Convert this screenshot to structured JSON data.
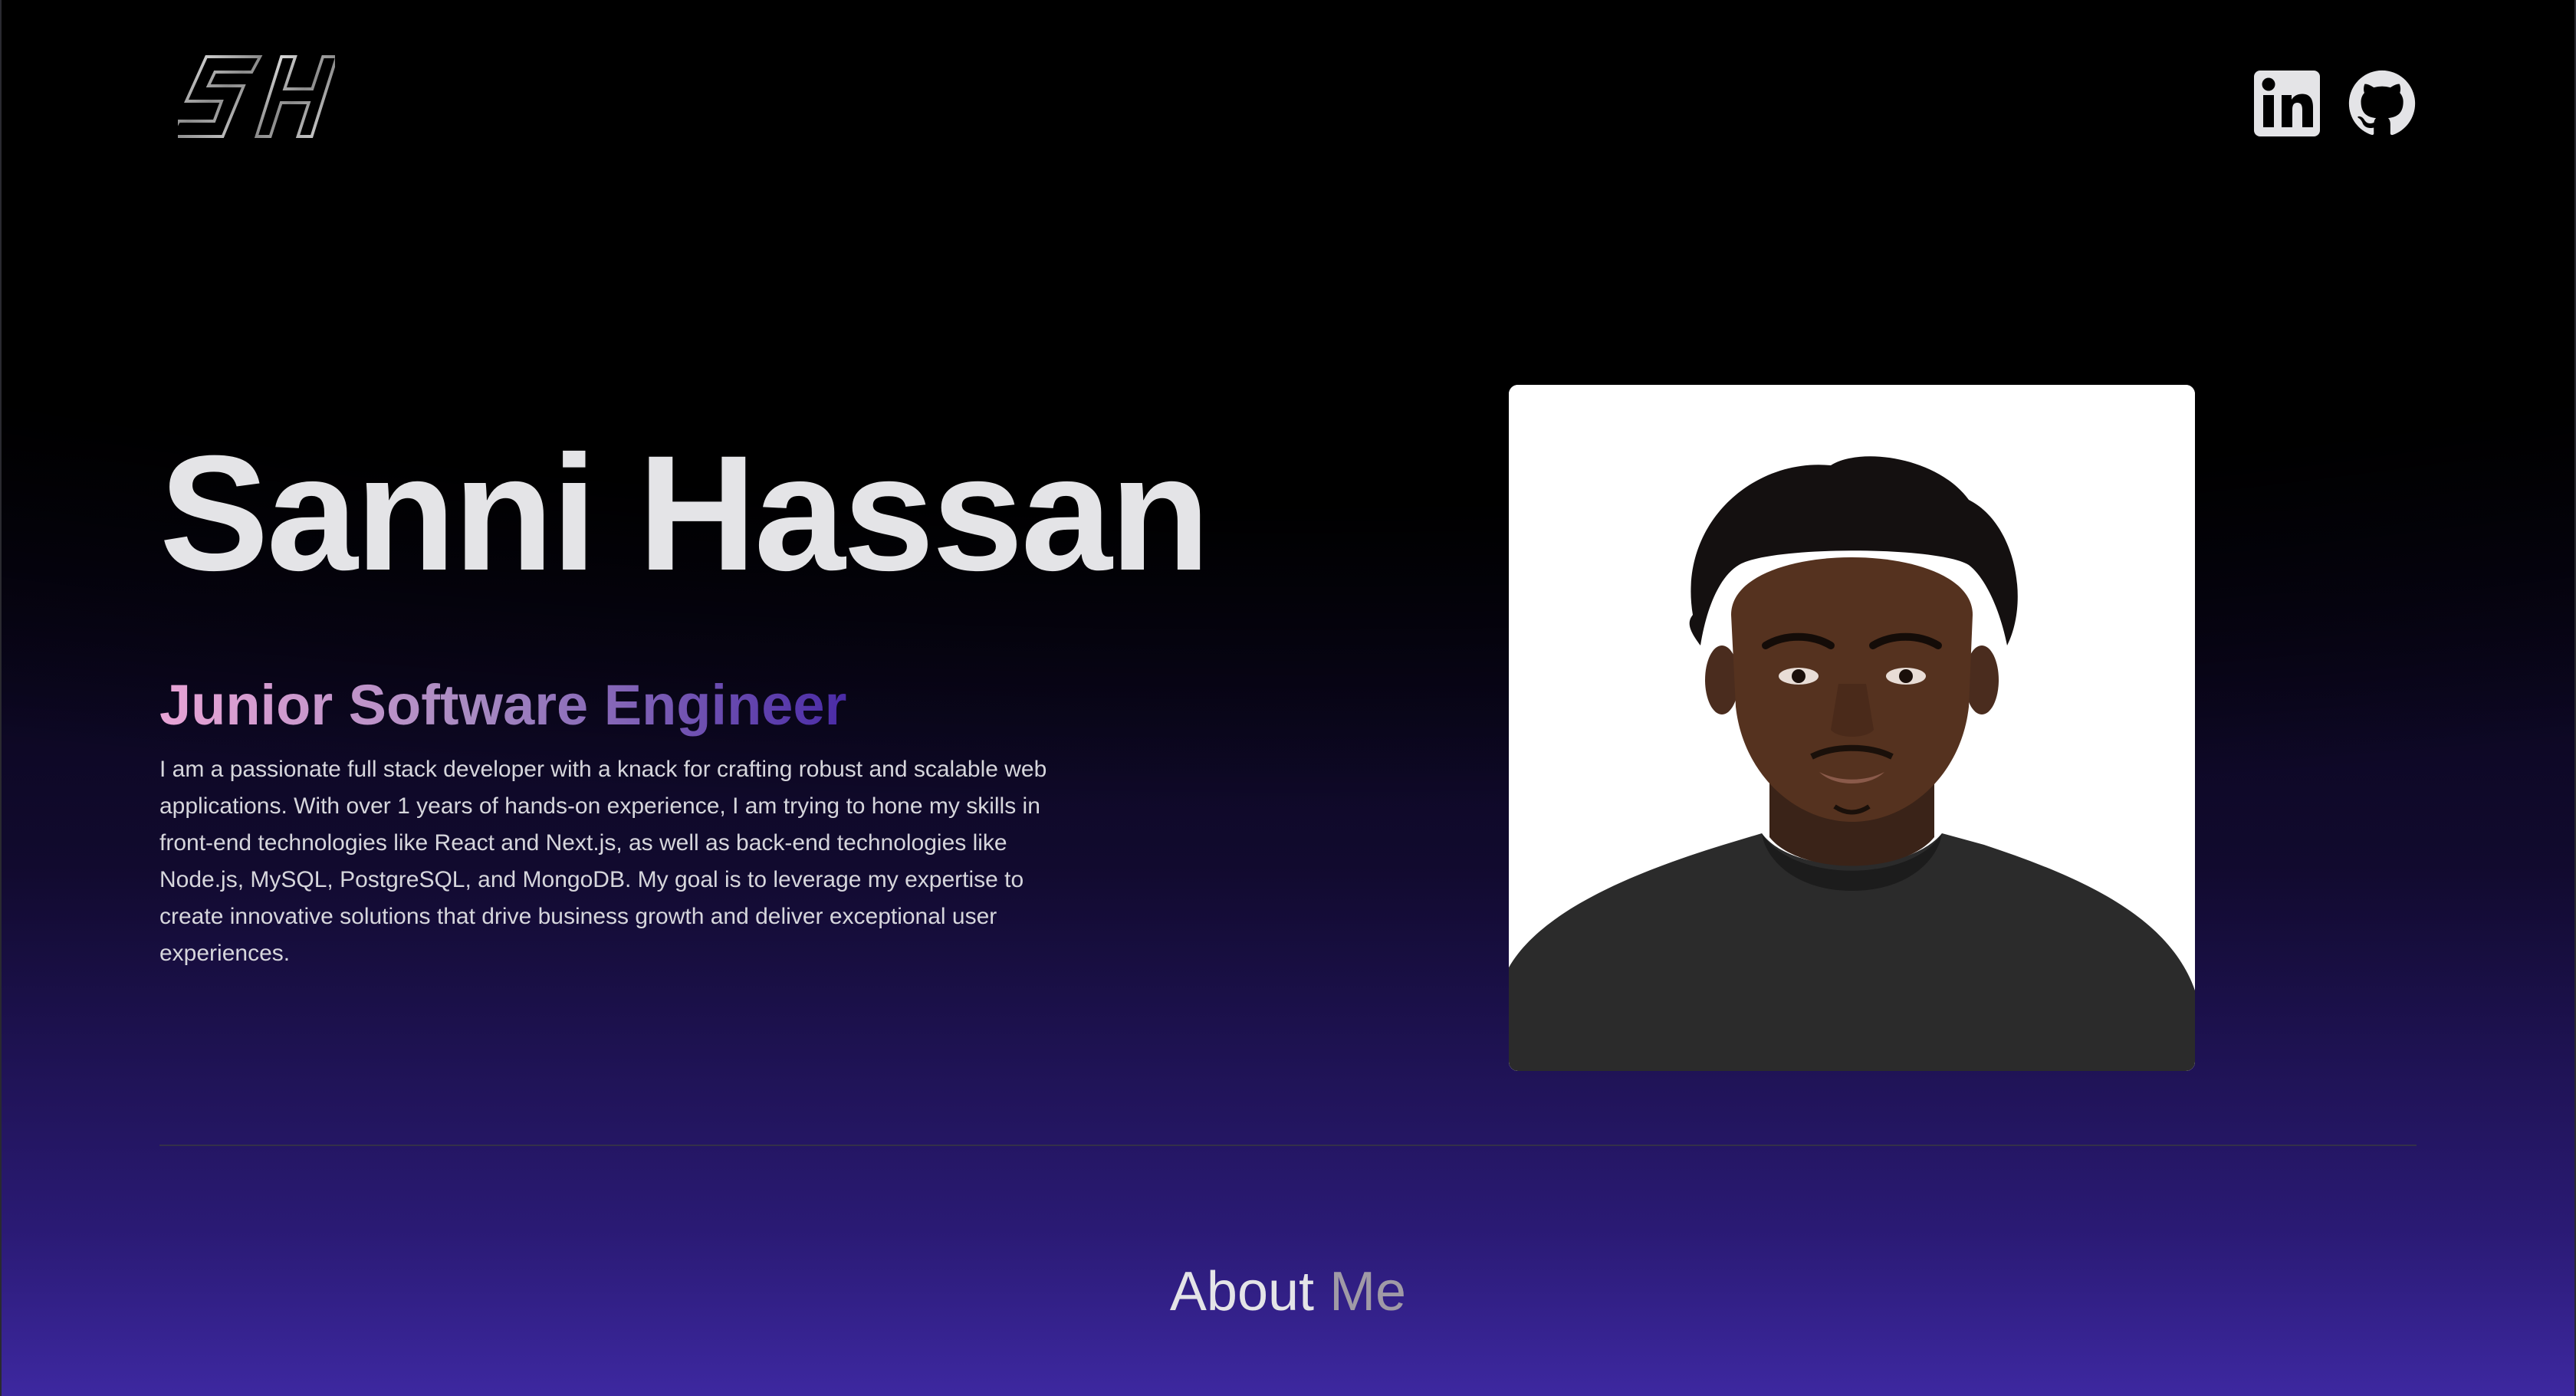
{
  "header": {
    "logo_text": "SH",
    "social": [
      {
        "icon": "linkedin-icon",
        "color": "#e4e4e7"
      },
      {
        "icon": "github-icon",
        "color": "#e4e4e7"
      }
    ]
  },
  "hero": {
    "name": "Sanni Hassan",
    "role": "Junior Software Engineer",
    "bio": "I am a passionate full stack developer with a knack for crafting robust and scalable web applications. With over 1 years of hands-on experience, I am trying to hone my skills in front-end technologies like React and Next.js, as well as back-end technologies like Node.js, MySQL, PostgreSQL, and MongoDB. My goal is to leverage my expertise to create innovative solutions that drive business growth and deliver exceptional user experiences."
  },
  "about": {
    "title_word_1": "About",
    "title_word_2": "Me"
  },
  "colors": {
    "background_top": "#000000",
    "background_bottom": "#3d28a0",
    "role_gradient_start": "#e8a4d6",
    "role_gradient_end": "#4a2ba6"
  }
}
